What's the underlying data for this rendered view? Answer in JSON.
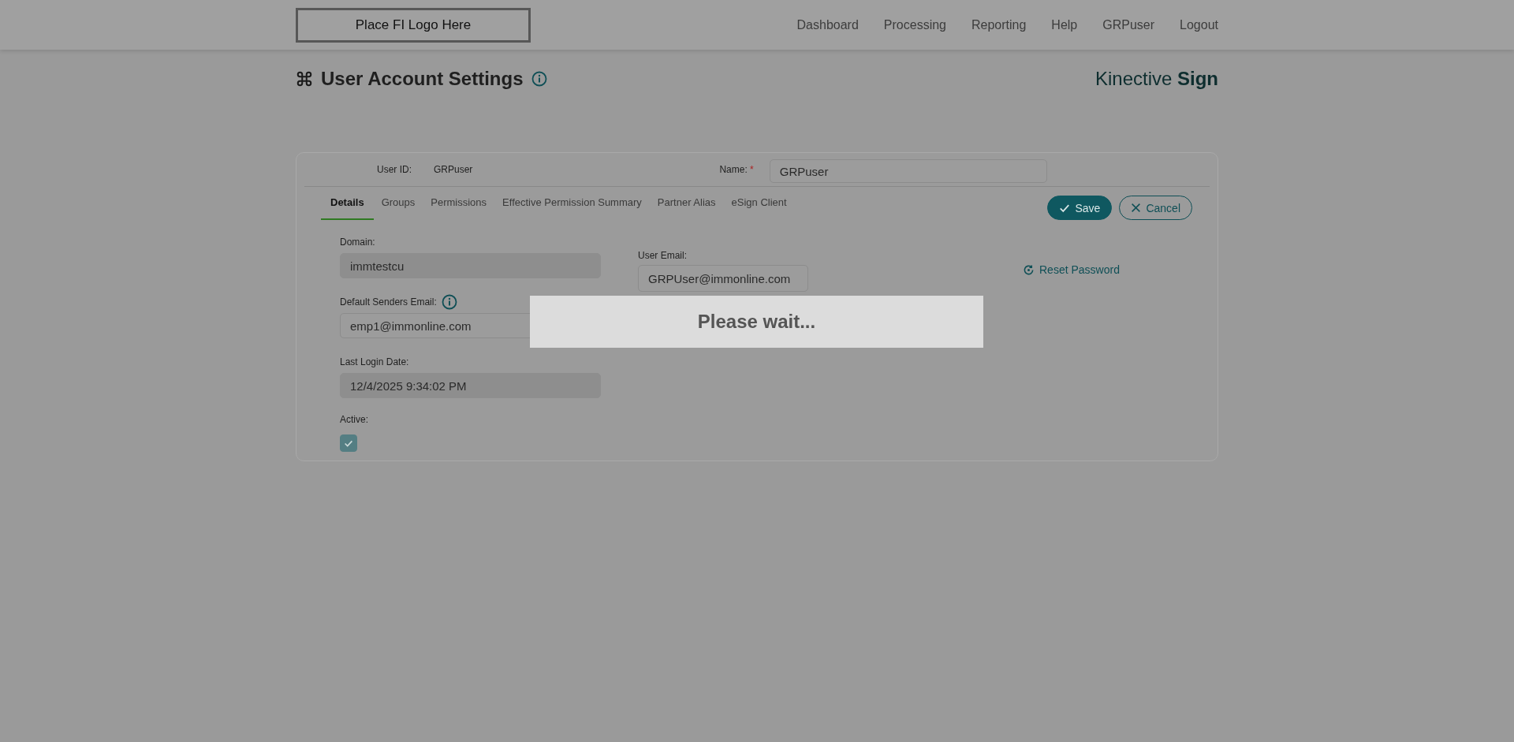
{
  "header": {
    "logo": "Place FI Logo Here",
    "nav": [
      "Dashboard",
      "Processing",
      "Reporting",
      "Help",
      "GRPuser",
      "Logout"
    ]
  },
  "page": {
    "title": "User Account Settings",
    "brand": "Kinective **Sign**"
  },
  "user": {
    "id_label": "User ID:",
    "id_value": "GRPuser",
    "name_label": "Name:",
    "required_mark": "*",
    "name_value": "GRPuser"
  },
  "tabs": [
    {
      "label": "Details",
      "selected": true
    },
    {
      "label": "Groups",
      "selected": false
    },
    {
      "label": "Permissions",
      "selected": false
    },
    {
      "label": "Effective Permission Summary",
      "selected": false
    },
    {
      "label": "Partner Alias",
      "selected": false
    },
    {
      "label": "eSign Client",
      "selected": false
    }
  ],
  "buttons": {
    "save": "Save",
    "cancel": "Cancel"
  },
  "left_fields": [
    {
      "label": "Domain:",
      "value": "immtestcu",
      "disabled": true,
      "info": false
    },
    {
      "label": "Default Senders Email:",
      "value": "emp1@immonline.com",
      "disabled": false,
      "info": true
    },
    {
      "label": "Last Login Date:",
      "value": "12/4/2025 9:34:02 PM",
      "disabled": true,
      "info": false
    }
  ],
  "active": {
    "label": "Active:",
    "checked": true
  },
  "user_email": {
    "label": "User Email:",
    "value": "GRPUser@immonline.com",
    "disabled": false
  },
  "reset_password": "Reset Password",
  "loading": {
    "text": "Please wait..."
  }
}
